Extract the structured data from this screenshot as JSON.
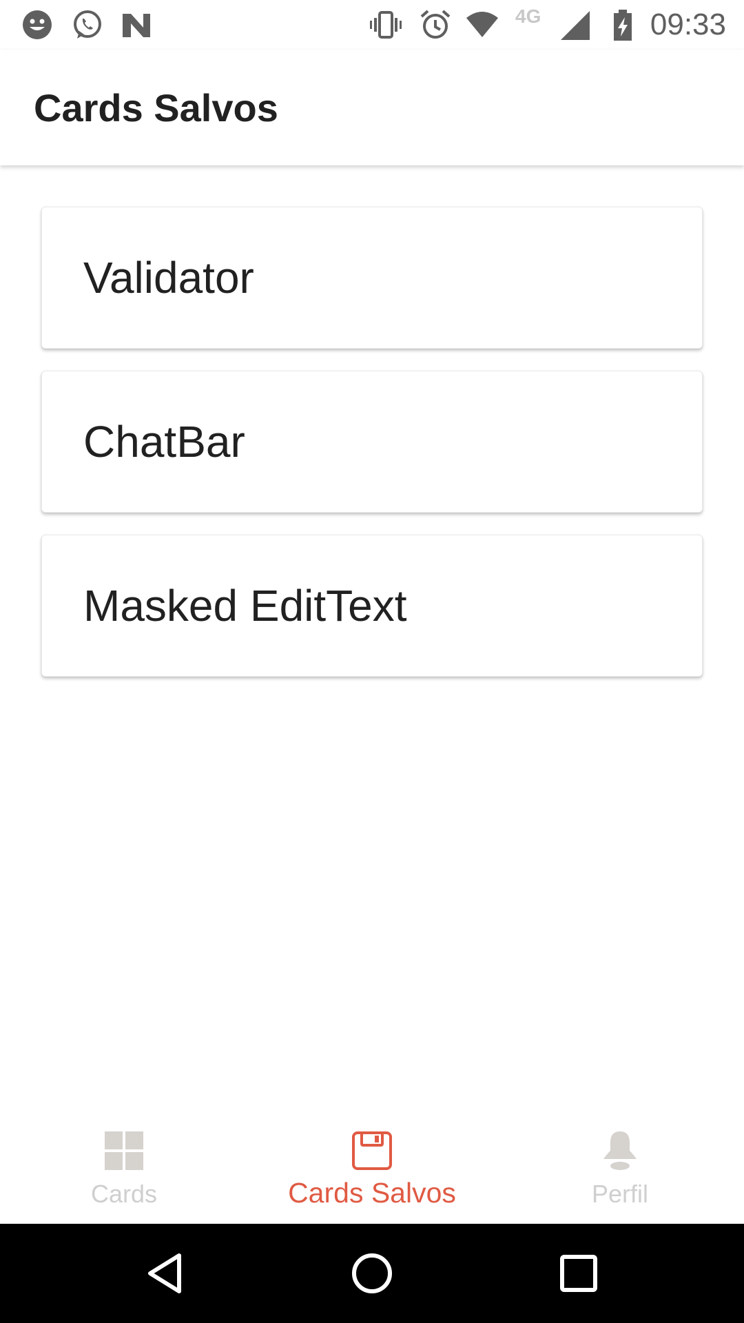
{
  "status_bar": {
    "time": "09:33",
    "network_type": "4G",
    "icons": [
      "emoji-icon",
      "whatsapp-icon",
      "n-app-icon",
      "vibrate-icon",
      "alarm-icon",
      "wifi-icon",
      "signal-icon",
      "battery-charging-icon"
    ]
  },
  "app_bar": {
    "title": "Cards Salvos"
  },
  "cards": [
    {
      "title": "Validator"
    },
    {
      "title": "ChatBar"
    },
    {
      "title": "Masked EditText"
    }
  ],
  "bottom_nav": {
    "items": [
      {
        "label": "Cards",
        "icon": "grid-icon",
        "active": false
      },
      {
        "label": "Cards Salvos",
        "icon": "save-icon",
        "active": true
      },
      {
        "label": "Perfil",
        "icon": "person-icon",
        "active": false
      }
    ]
  },
  "colors": {
    "accent": "#e05a43",
    "inactive": "#cfcfcf",
    "text": "#212121"
  },
  "system_nav": {
    "buttons": [
      "back-icon",
      "home-icon",
      "recents-icon"
    ]
  }
}
